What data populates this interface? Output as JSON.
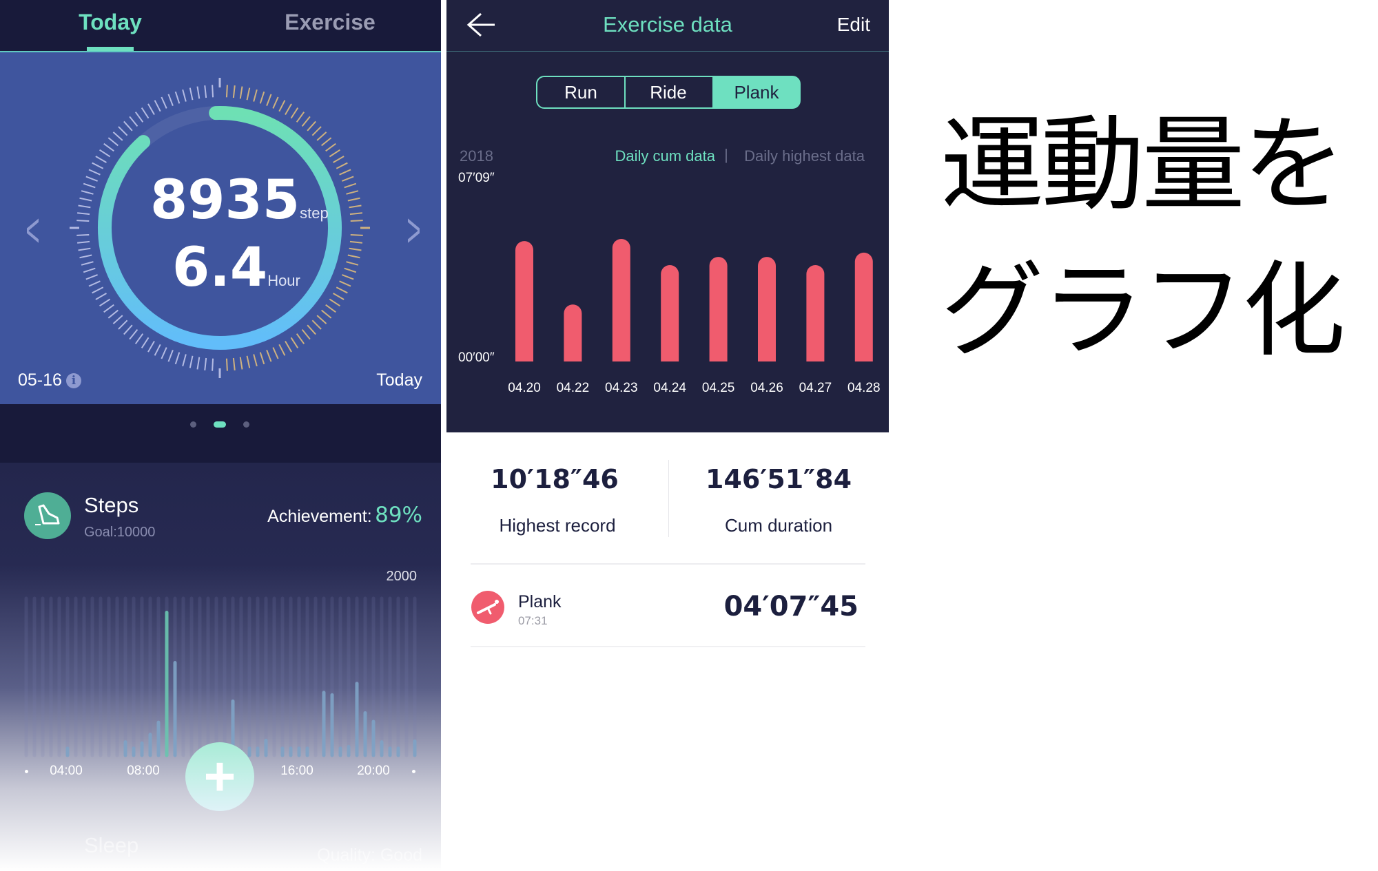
{
  "left": {
    "tabs": [
      {
        "label": "Today",
        "active": true
      },
      {
        "label": "Exercise",
        "active": false
      }
    ],
    "gauge": {
      "steps": "8935",
      "steps_unit": "step",
      "hours": "6.4",
      "hours_unit": "Hour",
      "progress_percent": 89
    },
    "date": "05-16",
    "today_label": "Today",
    "page_dots": {
      "count": 3,
      "active": 2
    },
    "steps_card": {
      "title": "Steps",
      "goal": "Goal:10000",
      "achievement_label": "Achievement:",
      "achievement_value": "89%"
    },
    "chart_max_label": "2000",
    "time_labels": [
      "04:00",
      "08:00",
      "16:00",
      "20:00"
    ],
    "sleep_label": "Sleep",
    "quality_label": "Quality: Good"
  },
  "right": {
    "title": "Exercise data",
    "edit": "Edit",
    "segments": [
      {
        "label": "Run",
        "active": false
      },
      {
        "label": "Ride",
        "active": false
      },
      {
        "label": "Plank",
        "active": true
      }
    ],
    "year": "2018",
    "toggle": {
      "cum": "Daily cum data",
      "separator": "|",
      "highest": "Daily highest data"
    },
    "y_top": "07′09″",
    "y_bottom": "00′00″",
    "stats": [
      {
        "value": "10′18″46",
        "label": "Highest record"
      },
      {
        "value": "146′51″84",
        "label": "Cum duration"
      }
    ],
    "record": {
      "name": "Plank",
      "time": "07:31",
      "duration": "04′07″45"
    }
  },
  "headline": {
    "line1": "運動量を",
    "line2": "グラフ化"
  },
  "colors": {
    "accent": "#6ee0c0",
    "bar": "#f05c6e",
    "card": "#3f559e",
    "dark": "#181a3a"
  },
  "icons": {
    "back": "arrow-left-icon",
    "shoe": "shoe-icon",
    "plank": "plank-icon",
    "info": "info-icon",
    "add": "plus-icon"
  },
  "chart_data": [
    {
      "type": "bar",
      "categories": [
        "04.20",
        "04.22",
        "04.23",
        "04.24",
        "04.25",
        "04.26",
        "04.27",
        "04.28"
      ],
      "values_seconds": [
        281,
        133,
        286,
        225,
        244,
        244,
        225,
        254
      ],
      "ylim_seconds": [
        0,
        429
      ],
      "ytick_labels": [
        "00′00″",
        "07′09″"
      ],
      "grid": false
    },
    {
      "type": "bar",
      "ylim": [
        0,
        2000
      ],
      "xtick_labels": [
        "04:00",
        "08:00",
        "16:00",
        "20:00"
      ],
      "values": [
        0,
        0,
        0,
        0,
        0,
        90,
        0,
        0,
        0,
        0,
        0,
        0,
        170,
        90,
        155,
        265,
        420,
        1820,
        1180,
        0,
        0,
        0,
        0,
        0,
        0,
        690,
        0,
        90,
        90,
        190,
        0,
        90,
        90,
        90,
        90,
        0,
        800,
        770,
        90,
        110,
        915,
        540,
        430,
        170,
        90,
        90,
        0,
        180
      ],
      "grid": false
    }
  ]
}
